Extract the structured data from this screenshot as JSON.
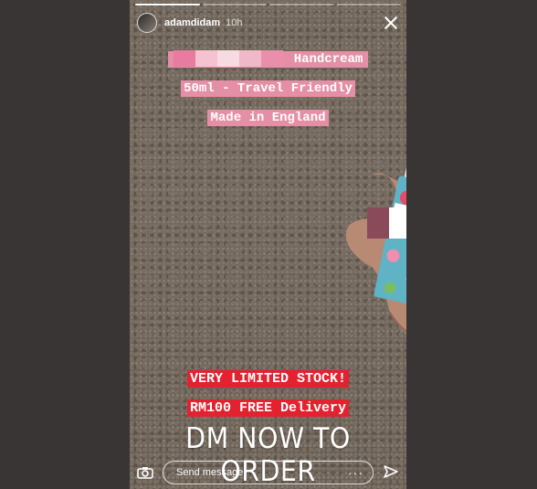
{
  "story": {
    "username": "adamdidam",
    "time": "10h",
    "progress_segments": 4,
    "progress_done": 1
  },
  "captions": {
    "line1_suffix": "Handcream",
    "line2": "50ml - Travel Friendly",
    "line3": "Made in England",
    "line4": "VERY LIMITED STOCK!",
    "line5": "RM100 FREE Delivery",
    "cta": "DM NOW TO ORDER"
  },
  "footer": {
    "send_placeholder": "Send message",
    "more_label": "···"
  },
  "icons": {
    "close": "close-icon",
    "camera": "camera-icon",
    "send": "send-icon",
    "more": "more-icon"
  },
  "colors": {
    "pink_caption": "#e58fa6",
    "red_caption": "#e3222f",
    "text": "#ffffff"
  }
}
